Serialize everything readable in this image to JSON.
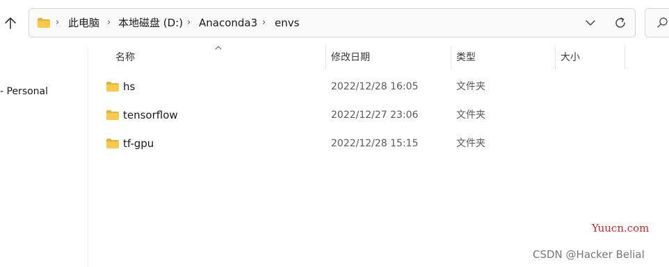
{
  "address_bar": {
    "breadcrumbs": [
      "此电脑",
      "本地磁盘 (D:)",
      "Anaconda3",
      "envs"
    ]
  },
  "navigation": {
    "items": [
      "- Personal"
    ]
  },
  "columns": {
    "name": "名称",
    "date_modified": "修改日期",
    "type": "类型",
    "size": "大小"
  },
  "files": [
    {
      "name": "hs",
      "date": "2022/12/28 16:05",
      "type": "文件夹",
      "size": ""
    },
    {
      "name": "tensorflow",
      "date": "2022/12/27 23:06",
      "type": "文件夹",
      "size": ""
    },
    {
      "name": "tf-gpu",
      "date": "2022/12/28 15:15",
      "type": "文件夹",
      "size": ""
    }
  ],
  "watermarks": {
    "site": "Yuucn.com",
    "author": "CSDN @Hacker Belial"
  },
  "colors": {
    "folder": "#f8c94a",
    "folder_dark": "#e8b230",
    "watermark_red": "#d0262b"
  }
}
